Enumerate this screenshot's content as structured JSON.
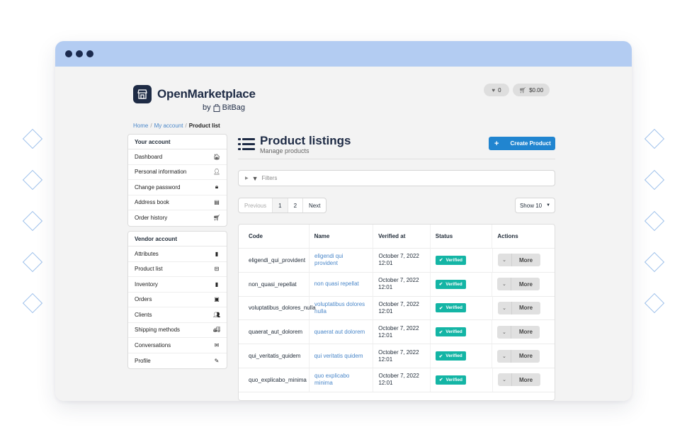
{
  "window": {
    "chrome_dots": 3
  },
  "header": {
    "brand": "OpenMarketplace",
    "by": "by",
    "by_brand": "BitBag",
    "wishlist_count": "0",
    "cart_total": "$0.00"
  },
  "breadcrumb": {
    "home": "Home",
    "account": "My account",
    "current": "Product list"
  },
  "your_account": {
    "title": "Your account",
    "items": [
      {
        "label": "Dashboard",
        "icon": "home-icon",
        "glyph": "🏠︎"
      },
      {
        "label": "Personal information",
        "icon": "user-icon",
        "glyph": "👤︎"
      },
      {
        "label": "Change password",
        "icon": "lock-icon",
        "glyph": "🔒︎"
      },
      {
        "label": "Address book",
        "icon": "book-icon",
        "glyph": "▤"
      },
      {
        "label": "Order history",
        "icon": "cart-icon",
        "glyph": "🛒︎"
      }
    ]
  },
  "vendor_account": {
    "title": "Vendor account",
    "items": [
      {
        "label": "Attributes",
        "icon": "clipboard-icon",
        "glyph": "▮"
      },
      {
        "label": "Product list",
        "icon": "inbox-icon",
        "glyph": "⊟"
      },
      {
        "label": "Inventory",
        "icon": "clipboard-icon",
        "glyph": "▮"
      },
      {
        "label": "Orders",
        "icon": "suitcase-icon",
        "glyph": "▣"
      },
      {
        "label": "Clients",
        "icon": "users-icon",
        "glyph": "👥︎"
      },
      {
        "label": "Shipping methods",
        "icon": "truck-icon",
        "glyph": "🚚︎"
      },
      {
        "label": "Conversations",
        "icon": "envelope-open-icon",
        "glyph": "✉︎"
      },
      {
        "label": "Profile",
        "icon": "pencil-icon",
        "glyph": "✎"
      }
    ]
  },
  "main": {
    "title": "Product listings",
    "subtitle": "Manage products",
    "create_button": "Create Product",
    "filters_label": "Filters",
    "pagination": {
      "previous": "Previous",
      "pages": [
        "1",
        "2"
      ],
      "next": "Next",
      "active_page": "1"
    },
    "per_page": "Show 10"
  },
  "table": {
    "columns": [
      "Code",
      "Name",
      "Verified at",
      "Status",
      "Actions"
    ],
    "rows": [
      {
        "code": "eligendi_qui_provident",
        "name": "eligendi qui provident",
        "verified_at": "October 7, 2022 12:01",
        "status": "Verified",
        "action": "More"
      },
      {
        "code": "non_quasi_repellat",
        "name": "non quasi repellat",
        "verified_at": "October 7, 2022 12:01",
        "status": "Verified",
        "action": "More"
      },
      {
        "code": "voluptatibus_dolores_nulla",
        "name": "voluptatibus dolores nulla",
        "verified_at": "October 7, 2022 12:01",
        "status": "Verified",
        "action": "More"
      },
      {
        "code": "quaerat_aut_dolorem",
        "name": "quaerat aut dolorem",
        "verified_at": "October 7, 2022 12:01",
        "status": "Verified",
        "action": "More"
      },
      {
        "code": "qui_veritatis_quidem",
        "name": "qui veritatis quidem",
        "verified_at": "October 7, 2022 12:01",
        "status": "Verified",
        "action": "More"
      },
      {
        "code": "quo_explicabo_minima",
        "name": "quo explicabo minima",
        "verified_at": "October 7, 2022 12:01",
        "status": "Verified",
        "action": "More"
      }
    ]
  },
  "colors": {
    "titlebar": "#b3ccf2",
    "brand_dark": "#1e2b45",
    "primary": "#2185d0",
    "verified": "#14b5a5",
    "link": "#4a87c9"
  }
}
